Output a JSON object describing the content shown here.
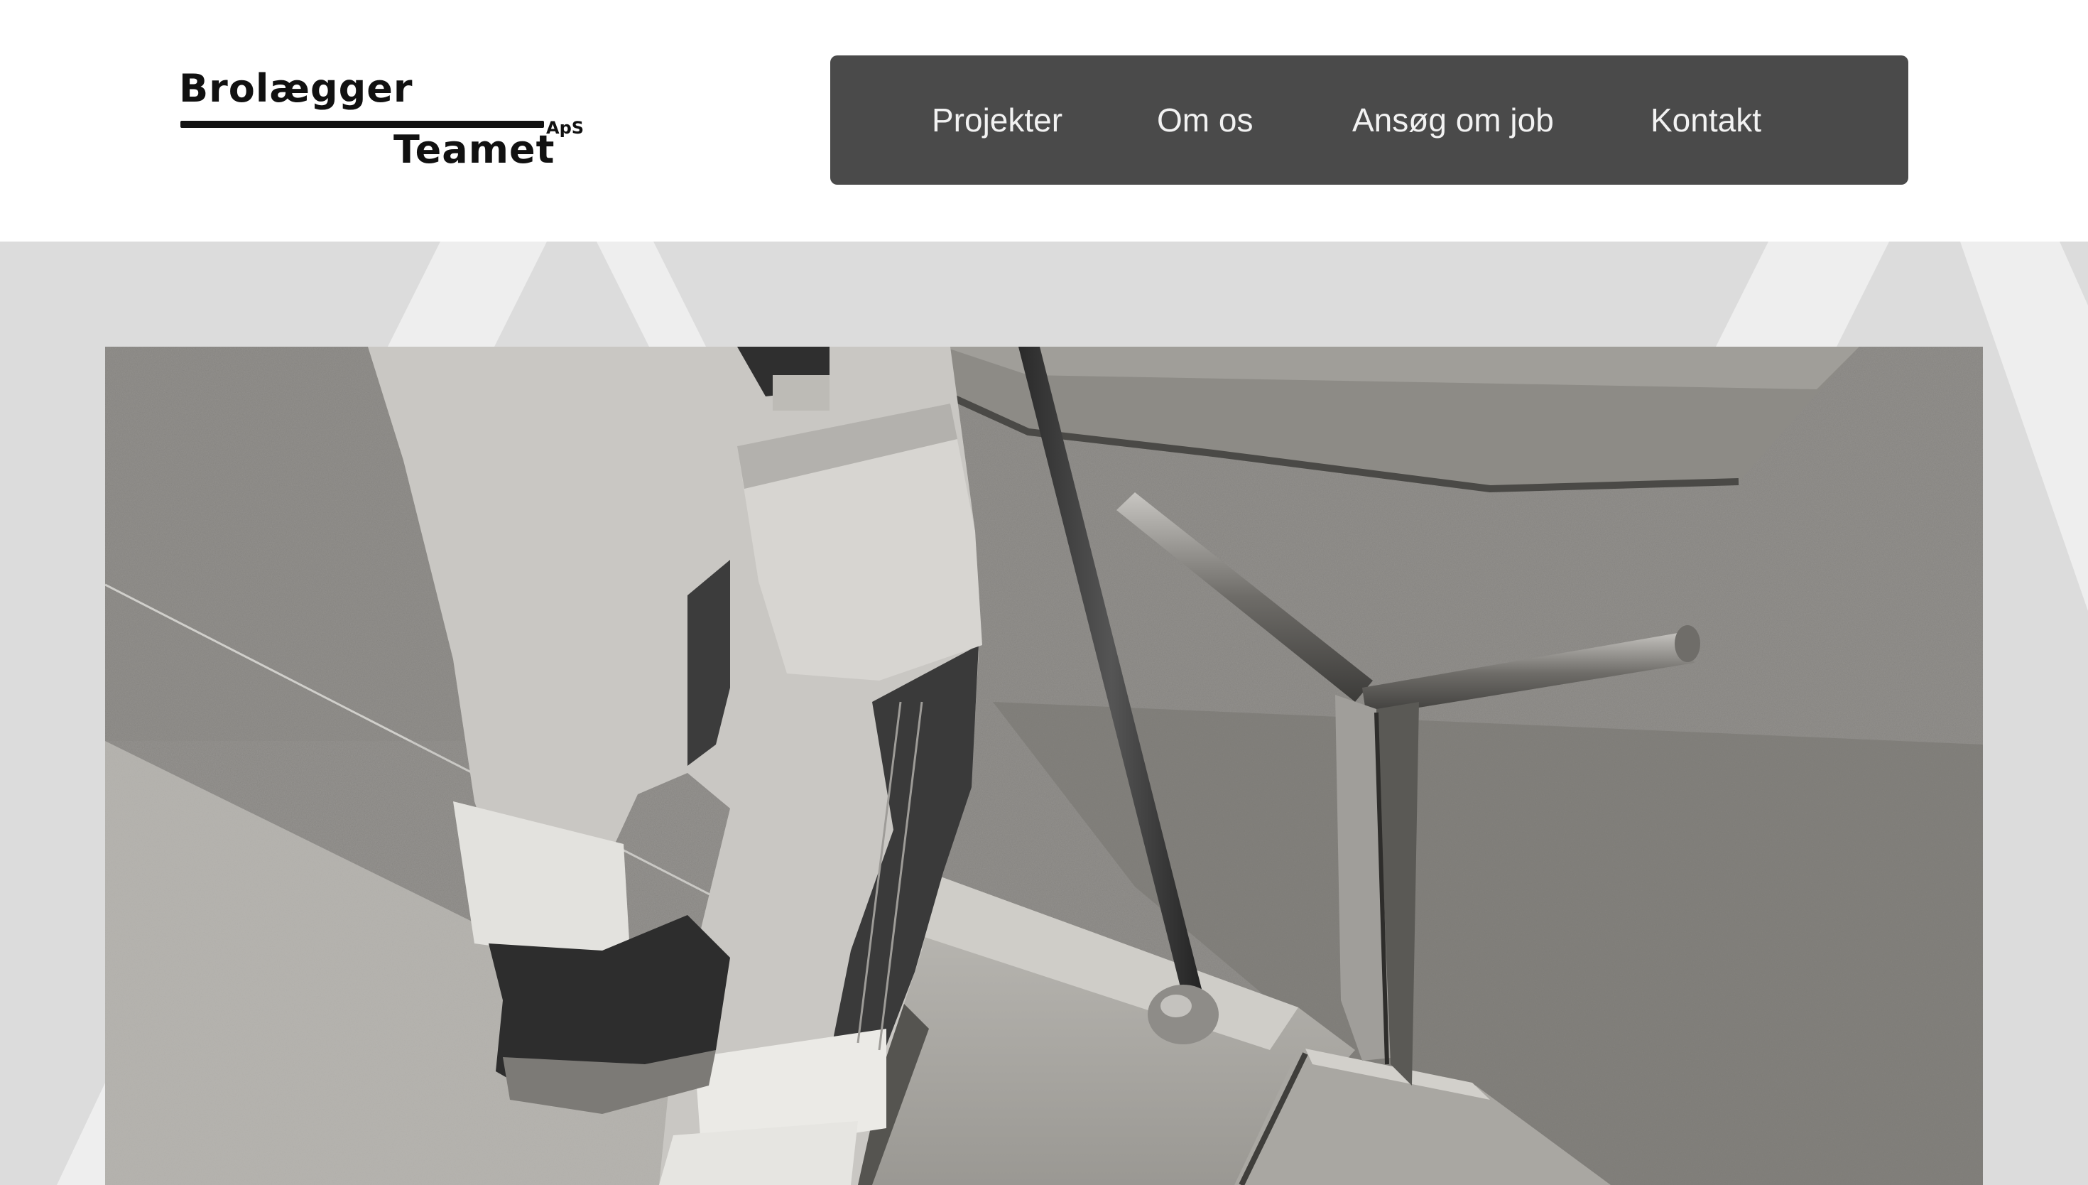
{
  "brand": {
    "line1": "Brolægger",
    "line2": "Teamet",
    "suffix": "ApS"
  },
  "nav": {
    "items": [
      {
        "label": "Projekter"
      },
      {
        "label": "Om os"
      },
      {
        "label": "Ansøg om job"
      },
      {
        "label": "Kontakt"
      }
    ]
  },
  "theme": {
    "nav_background": "#4a4a4a",
    "nav_text": "#f2f2f2",
    "hero_background": "#dcdcdc",
    "header_background": "#ffffff"
  },
  "hero": {
    "image_subject": "Black-and-white photo of a paver worker in work trousers with reflective bands standing beside a curb, with a steel rod and a T-shaped tool in a sand bed"
  }
}
